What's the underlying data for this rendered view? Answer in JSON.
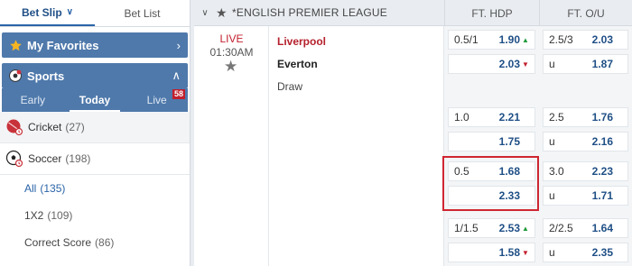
{
  "sidebar": {
    "tabs": [
      {
        "label": "Bet Slip",
        "active": true
      },
      {
        "label": "Bet List",
        "active": false
      }
    ],
    "favorites_label": "My Favorites",
    "sports_label": "Sports",
    "time_tabs": [
      {
        "label": "Early"
      },
      {
        "label": "Today"
      },
      {
        "label": "Live"
      }
    ],
    "live_count": "58",
    "sports": [
      {
        "name": "Cricket",
        "count": "(27)"
      },
      {
        "name": "Soccer",
        "count": "(198)"
      }
    ],
    "soccer_sub": [
      {
        "name": "All",
        "count": "(135)"
      },
      {
        "name": "1X2",
        "count": "(109)"
      },
      {
        "name": "Correct Score",
        "count": "(86)"
      }
    ]
  },
  "league": {
    "title": "*ENGLISH PREMIER LEAGUE",
    "col_hdp": "FT. HDP",
    "col_ou": "FT. O/U"
  },
  "match": {
    "status": "LIVE",
    "time": "01:30AM",
    "home": "Liverpool",
    "away": "Everton",
    "draw": "Draw"
  },
  "hdp": [
    {
      "line": "0.5/1",
      "price": "1.90",
      "dir": "up"
    },
    {
      "line": "",
      "price": "2.03",
      "dir": "down"
    },
    {
      "line": "1.0",
      "price": "2.21",
      "dir": ""
    },
    {
      "line": "",
      "price": "1.75",
      "dir": ""
    },
    {
      "line": "0.5",
      "price": "1.68",
      "dir": ""
    },
    {
      "line": "",
      "price": "2.33",
      "dir": ""
    },
    {
      "line": "1/1.5",
      "price": "2.53",
      "dir": "up"
    },
    {
      "line": "",
      "price": "1.58",
      "dir": "down"
    }
  ],
  "ou": [
    {
      "line": "2.5/3",
      "price": "2.03",
      "dir": ""
    },
    {
      "line": "u",
      "price": "1.87",
      "dir": ""
    },
    {
      "line": "2.5",
      "price": "1.76",
      "dir": ""
    },
    {
      "line": "u",
      "price": "2.16",
      "dir": ""
    },
    {
      "line": "3.0",
      "price": "2.23",
      "dir": ""
    },
    {
      "line": "u",
      "price": "1.71",
      "dir": ""
    },
    {
      "line": "2/2.5",
      "price": "1.64",
      "dir": ""
    },
    {
      "line": "u",
      "price": "2.35",
      "dir": ""
    }
  ]
}
